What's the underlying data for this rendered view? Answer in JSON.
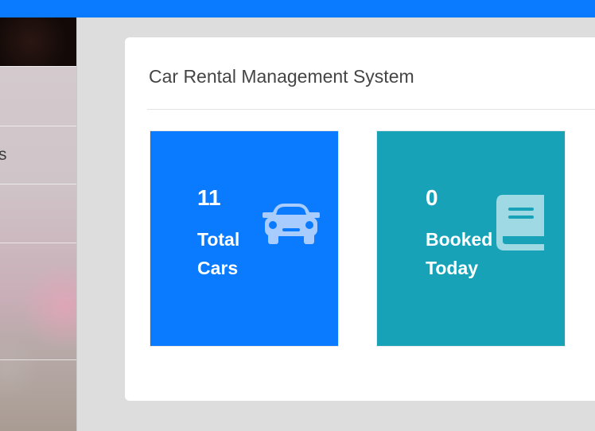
{
  "sidebar": {
    "items": [
      {
        "label": ""
      },
      {
        "label": "s"
      },
      {
        "label": ""
      },
      {
        "label": ""
      },
      {
        "label": ""
      }
    ]
  },
  "panel": {
    "title": "Car Rental Management System"
  },
  "cards": [
    {
      "number": "11",
      "label": "Total Cars",
      "icon": "car-icon",
      "color": "#0a7bff"
    },
    {
      "number": "0",
      "label": "Booked Today",
      "icon": "book-icon",
      "color": "#17a2b8"
    }
  ],
  "theme": {
    "accent": "#0a7bff",
    "teal": "#17a2b8"
  }
}
